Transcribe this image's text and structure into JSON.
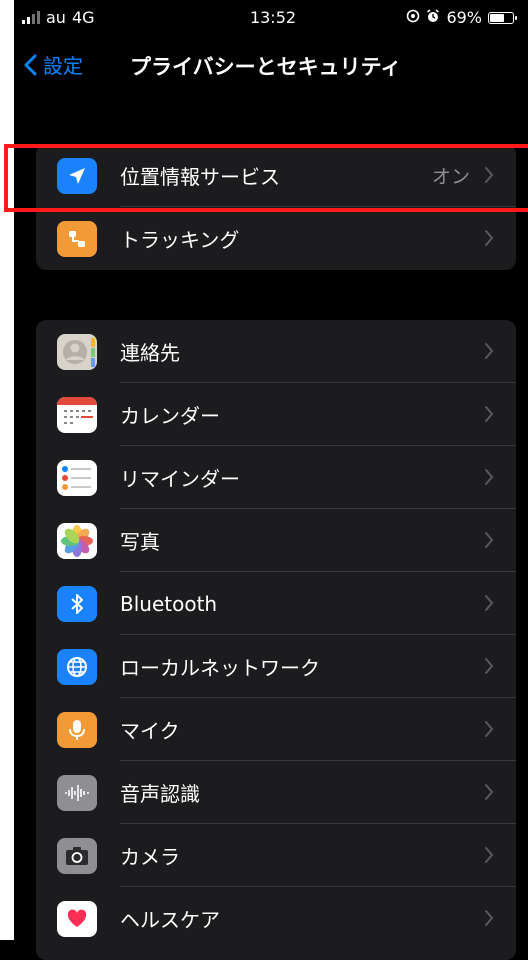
{
  "status_bar": {
    "carrier": "au",
    "network": "4G",
    "time": "13:52",
    "battery": "69%",
    "battery_level": 0.69
  },
  "navigation": {
    "back_label": "設定",
    "title": "プライバシーとセキュリティ"
  },
  "group1": [
    {
      "label": "位置情報サービス",
      "value": "オン",
      "icon": "location-arrow-icon",
      "color": "#1a82fb"
    },
    {
      "label": "トラッキング",
      "value": "",
      "icon": "tracking-icon",
      "color": "#f19a37"
    }
  ],
  "group2": [
    {
      "label": "連絡先",
      "icon": "contacts-icon"
    },
    {
      "label": "カレンダー",
      "icon": "calendar-icon"
    },
    {
      "label": "リマインダー",
      "icon": "reminders-icon"
    },
    {
      "label": "写真",
      "icon": "photos-icon"
    },
    {
      "label": "Bluetooth",
      "icon": "bluetooth-icon",
      "color": "#1a82fb"
    },
    {
      "label": "ローカルネットワーク",
      "icon": "globe-icon",
      "color": "#1a82fb"
    },
    {
      "label": "マイク",
      "icon": "microphone-icon",
      "color": "#f19a37"
    },
    {
      "label": "音声認識",
      "icon": "waveform-icon",
      "color": "#8e8e93"
    },
    {
      "label": "カメラ",
      "icon": "camera-icon",
      "color": "#8e8e93"
    },
    {
      "label": "ヘルスケア",
      "icon": "heart-icon",
      "color": "#ffffff"
    }
  ],
  "colors": {
    "accent": "#0a84ff",
    "highlight": "#ff1a1a",
    "group_bg": "#1c1c1e",
    "separator": "#38383a",
    "secondary_text": "#8e8e93"
  }
}
